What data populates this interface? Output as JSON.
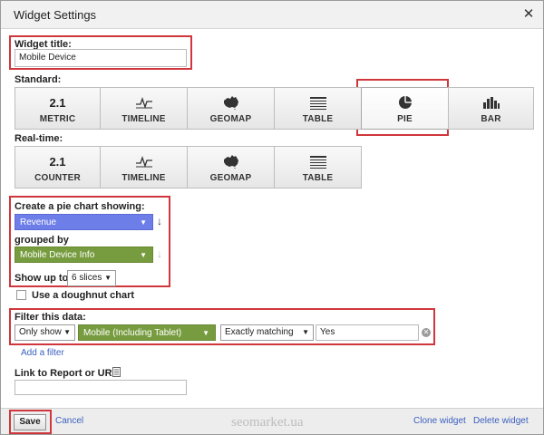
{
  "dialog": {
    "title": "Widget Settings",
    "close_symbol": "✕"
  },
  "widget_title": {
    "label": "Widget title:",
    "value": "Mobile Device"
  },
  "standard": {
    "label": "Standard:",
    "buttons": [
      {
        "icon": "metric-icon",
        "icon_text": "2.1",
        "label": "METRIC",
        "selected": false
      },
      {
        "icon": "timeline-icon",
        "label": "TIMELINE",
        "selected": false
      },
      {
        "icon": "geomap-icon",
        "label": "GEOMAP",
        "selected": false
      },
      {
        "icon": "table-icon",
        "label": "TABLE",
        "selected": false
      },
      {
        "icon": "pie-icon",
        "label": "PIE",
        "selected": true
      },
      {
        "icon": "bar-icon",
        "label": "BAR",
        "selected": false
      }
    ]
  },
  "realtime": {
    "label": "Real-time:",
    "buttons": [
      {
        "icon": "counter-icon",
        "icon_text": "2.1",
        "label": "COUNTER"
      },
      {
        "icon": "timeline-icon",
        "label": "TIMELINE"
      },
      {
        "icon": "geomap-icon",
        "label": "GEOMAP"
      },
      {
        "icon": "table-icon",
        "label": "TABLE"
      }
    ]
  },
  "pie_config": {
    "showing_label": "Create a pie chart showing:",
    "metric": "Revenue",
    "grouped_label": "grouped by",
    "dimension": "Mobile Device Info",
    "show_up_to_label": "Show up to",
    "slices": "6 slices",
    "doughnut_label": "Use a doughnut chart"
  },
  "filter": {
    "label": "Filter this data:",
    "mode": "Only show",
    "dimension": "Mobile (Including Tablet)",
    "match": "Exactly matching",
    "value": "Yes",
    "add_filter": "Add a filter"
  },
  "link_report": {
    "label": "Link to Report or URL:",
    "value": ""
  },
  "footer": {
    "save": "Save",
    "cancel": "Cancel",
    "watermark": "seomarket.ua",
    "clone": "Clone widget",
    "delete": "Delete widget"
  },
  "colors": {
    "highlight": "#d0373c",
    "metric_dropdown": "#6e7ee8",
    "dimension_dropdown": "#779c3f",
    "link": "#3b5fbf"
  }
}
